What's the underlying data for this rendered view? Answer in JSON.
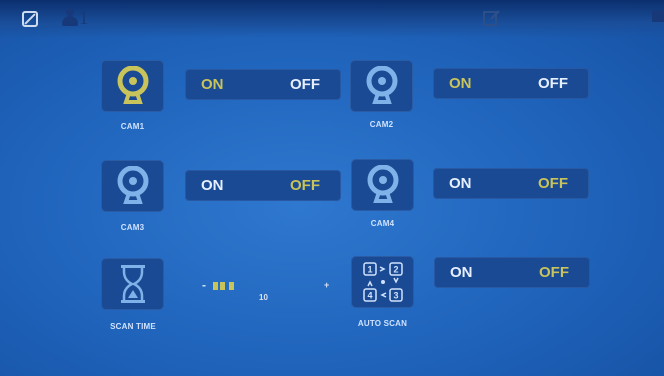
{
  "colors": {
    "background": "#1f63bb",
    "tile": "#1a4a93",
    "active": "#c8c35a",
    "text": "#e6efff"
  },
  "header": {
    "left_icon": "no-sd-icon",
    "user_icon": "user-icon",
    "user_number": "1",
    "edit_icon": "edit-icon"
  },
  "cameras": [
    {
      "label": "CAM1",
      "on": "ON",
      "off": "OFF",
      "state": "on",
      "icon": "webcam-icon"
    },
    {
      "label": "CAM2",
      "on": "ON",
      "off": "OFF",
      "state": "on",
      "icon": "webcam-icon"
    },
    {
      "label": "CAM3",
      "on": "ON",
      "off": "OFF",
      "state": "off",
      "icon": "webcam-icon"
    },
    {
      "label": "CAM4",
      "on": "ON",
      "off": "OFF",
      "state": "on",
      "icon": "webcam-icon"
    }
  ],
  "scan_time": {
    "label": "SCAN TIME",
    "minus": "-",
    "plus": "+",
    "value": "10",
    "icon": "hourglass-icon"
  },
  "auto_scan": {
    "label": "AUTO SCAN",
    "on": "ON",
    "off": "OFF",
    "icon": "quad-scan-icon",
    "numbers": [
      "1",
      "2",
      "4",
      "3"
    ]
  }
}
